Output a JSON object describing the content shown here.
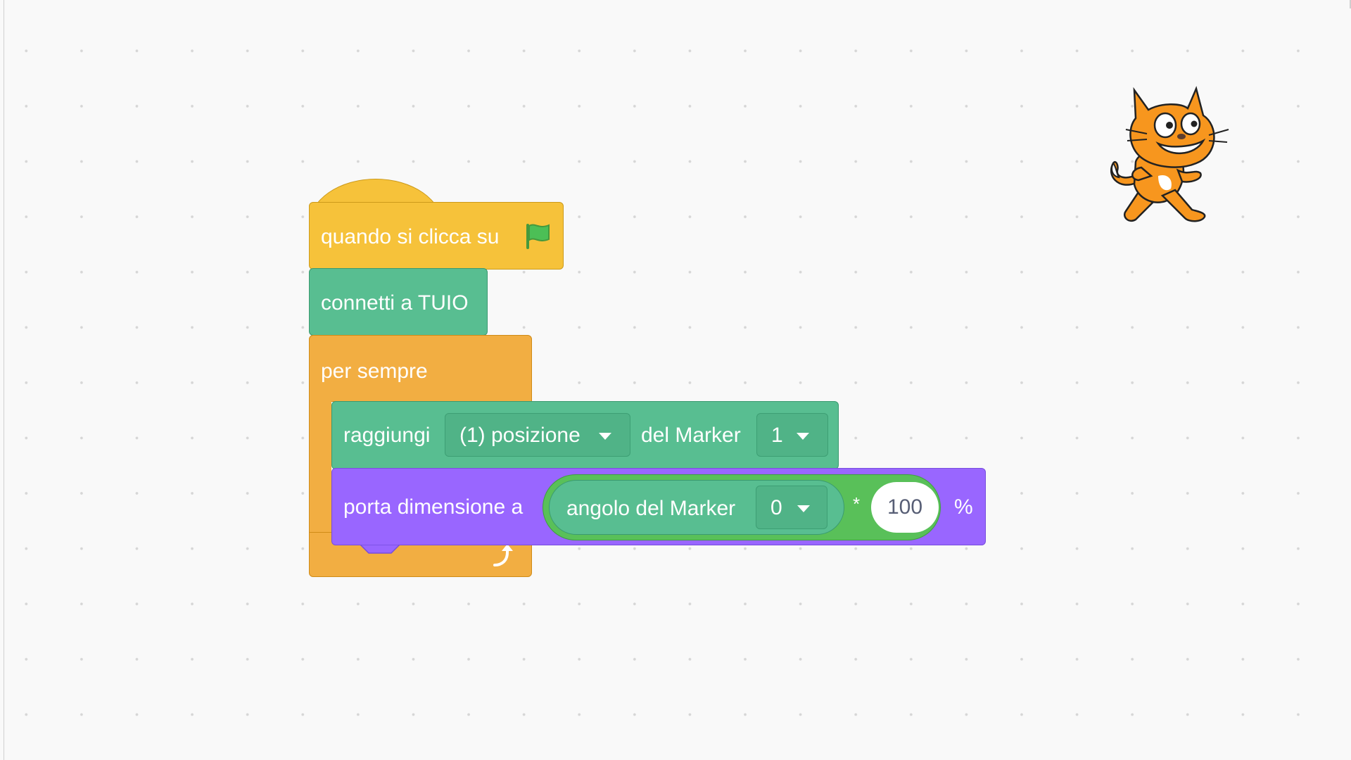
{
  "workspace": {
    "colors": {
      "events": "#f6c23a",
      "tuio": "#58be91",
      "control": "#f2ae42",
      "looks": "#9966ff",
      "operators": "#59c059",
      "background": "#f9f9f9"
    }
  },
  "script": {
    "hat": {
      "label": "quando si clicca su",
      "icon": "green-flag-icon"
    },
    "connect": {
      "label": "connetti a TUIO"
    },
    "forever": {
      "label": "per sempre",
      "icon": "repeat-arrow-icon"
    },
    "goto": {
      "label": "raggiungi",
      "dropdown_value": "(1) posizione",
      "label2": "del Marker",
      "marker_value": "1"
    },
    "set_size": {
      "label": "porta dimensione a",
      "reporter_label": "angolo del Marker",
      "reporter_value": "0",
      "operator": "*",
      "input_value": "100",
      "suffix": "%"
    }
  },
  "sprite": {
    "icon": "scratch-cat-icon"
  }
}
